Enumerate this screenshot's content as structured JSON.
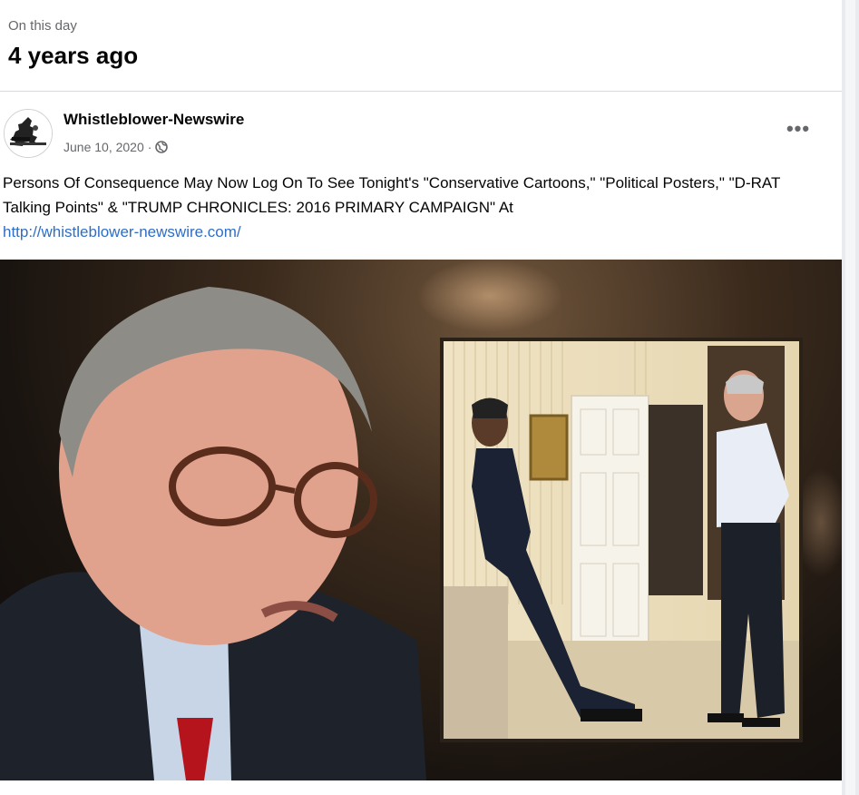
{
  "header": {
    "label": "On this day",
    "title": "4 years ago"
  },
  "post": {
    "author": "Whistleblower-Newswire",
    "date": "June 10, 2020",
    "separator": "·",
    "privacy_icon": "globe-icon",
    "more_icon": "more-options-icon",
    "more_label": "•••",
    "text": "Persons Of Consequence May Now Log On To See Tonight's \"Conservative Cartoons,\" \"Political Posters,\" \"D-RAT Talking Points\" & \"TRUMP CHRONICLES: 2016 PRIMARY CAMPAIGN\" At",
    "link": "http://whistleblower-newswire.com/"
  },
  "colors": {
    "text_primary": "#050505",
    "text_secondary": "#65676b",
    "link": "#2f6ec5",
    "divider": "#d7d9dd"
  }
}
